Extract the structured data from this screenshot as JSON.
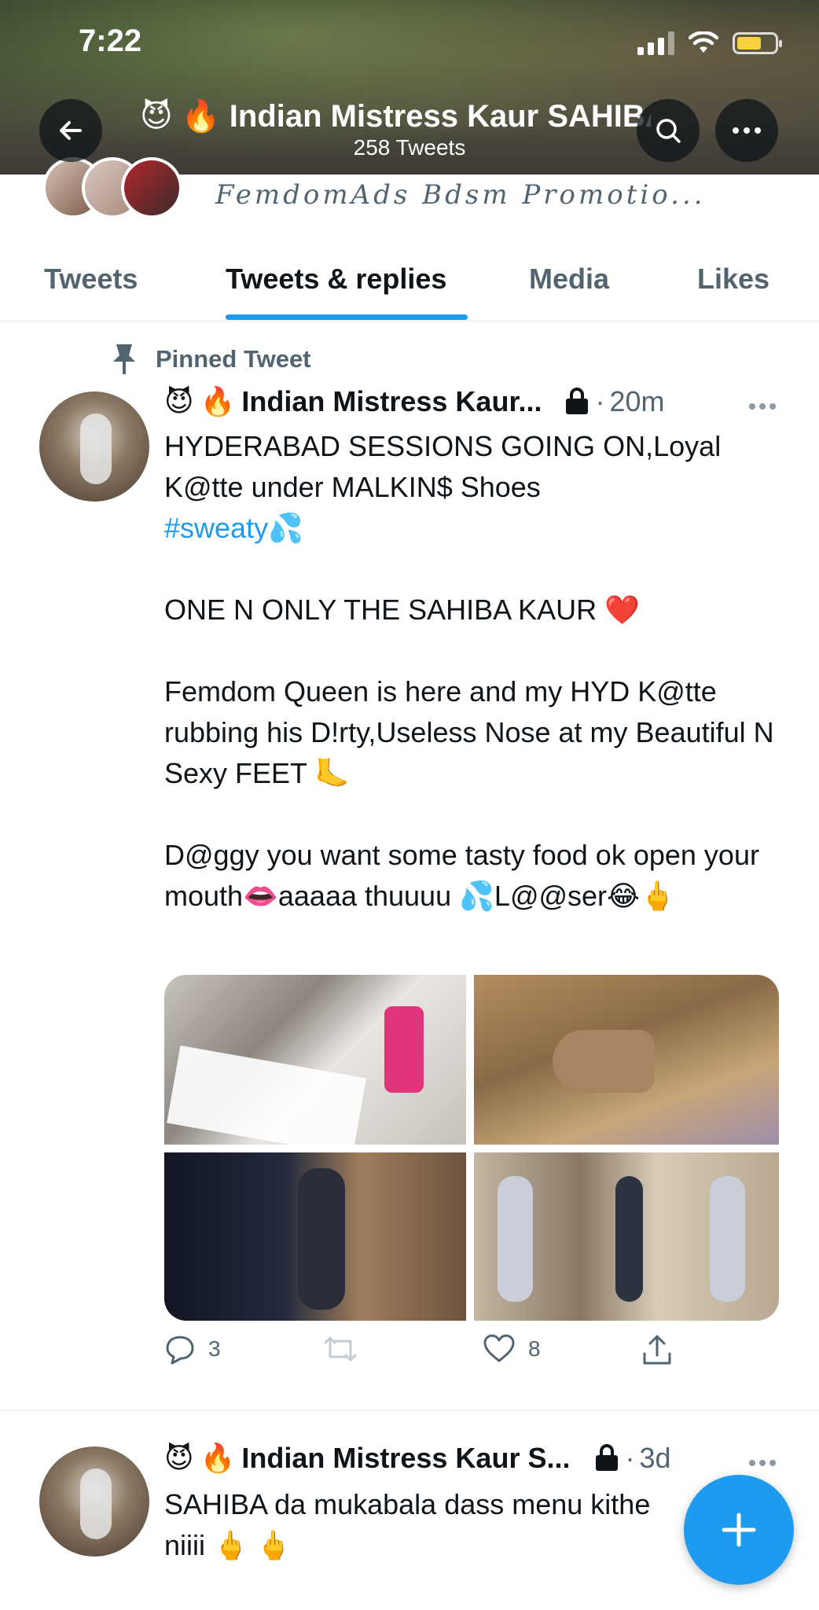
{
  "status_bar": {
    "time": "7:22"
  },
  "header": {
    "title": "Indian Mistress Kaur SAHIBA",
    "title_emojis": [
      "😈",
      "🔥"
    ],
    "tweet_count": "258 Tweets",
    "back_icon": "arrow-left-icon",
    "search_icon": "search-icon",
    "more_icon": "more-horizontal-icon"
  },
  "profile": {
    "promo_text": "FemdomAds Bdsm Promotio..."
  },
  "tabs": [
    {
      "label": "Tweets",
      "active": false
    },
    {
      "label": "Tweets & replies",
      "active": true
    },
    {
      "label": "Media",
      "active": false
    },
    {
      "label": "Likes",
      "active": false
    }
  ],
  "pinned": {
    "label": "Pinned Tweet"
  },
  "tweets": [
    {
      "emojis": [
        "😈",
        "🔥"
      ],
      "name": "Indian Mistress Kaur...",
      "time": "20m",
      "text": {
        "line1": "HYDERABAD SESSIONS GOING ON,Loyal K@tte under MALKIN$ Shoes",
        "hashtag": "#sweaty",
        "hashtag_emoji": "💦",
        "para2": "ONE N ONLY THE SAHIBA KAUR ❤️",
        "para3": "Femdom Queen is here and my HYD K@tte rubbing his D!rty,Useless Nose at my Beautiful N Sexy FEET 🦶",
        "para4": "D@ggy you want some tasty food ok open your mouth👄aaaaa thuuuu 💦L@@ser😂🖕"
      },
      "replies": "3",
      "retweets": "",
      "likes": "8"
    },
    {
      "emojis": [
        "😈",
        "🔥"
      ],
      "name": "Indian Mistress Kaur S...",
      "time": "3d",
      "text_line1": "SAHIBA da mukabala dass menu kithe",
      "text_line2": "niiii 🖕 🖕"
    }
  ],
  "colors": {
    "accent": "#1d9bf0",
    "secondary_text": "#536471",
    "primary_text": "#0f1419"
  }
}
